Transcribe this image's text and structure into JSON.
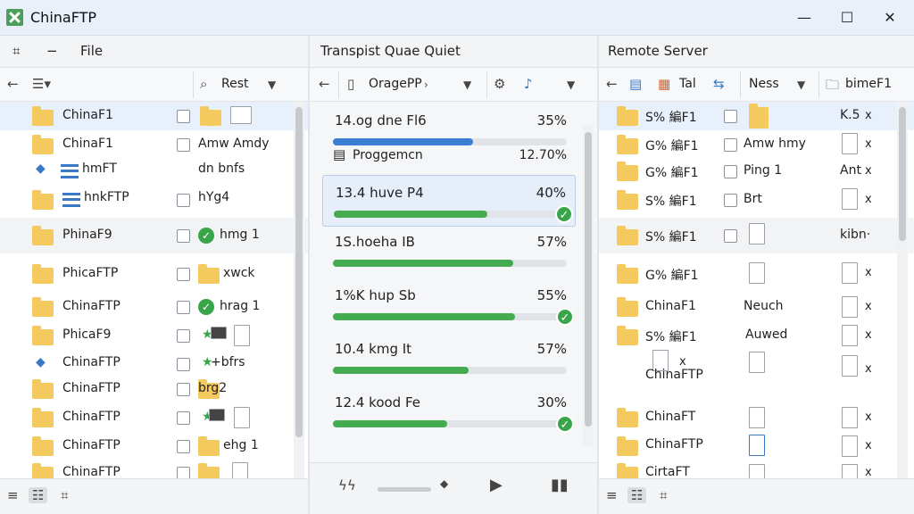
{
  "window": {
    "title": "ChinaFTP",
    "minimize": "—",
    "maximize": "☐",
    "close": "✕"
  },
  "left": {
    "tab_label": "File",
    "toolbar": {
      "sort_label": "Rest"
    },
    "rows": [
      {
        "name": "ChinaF1",
        "col2": ""
      },
      {
        "name": "ChinaF1",
        "col2": "Amw Amdy"
      },
      {
        "name": "hmFT",
        "col2": "dn bnfs"
      },
      {
        "name": "hnkFTP",
        "col2": "hYg4"
      },
      {
        "name": "PhinaF9",
        "col2": "hmg 1"
      },
      {
        "name": "PhicaFTP",
        "col2": "xwck"
      },
      {
        "name": "ChinaFTP",
        "col2": "hrag 1"
      },
      {
        "name": "PhicaF9",
        "col2": ""
      },
      {
        "name": "ChinaFTP",
        "col2": "+bfrs"
      },
      {
        "name": "ChinaFTP",
        "col2": "brg2"
      },
      {
        "name": "ChinaFTP",
        "col2": ""
      },
      {
        "name": "ChinaFTP",
        "col2": "ehg 1"
      },
      {
        "name": "ChinaFTP",
        "col2": ""
      }
    ]
  },
  "queue": {
    "tab_label": "Transpist Quae Quiet",
    "toolbar": {
      "server_label": "OragePP"
    },
    "items": [
      {
        "name": "14.og dne Fl6",
        "percent": "35%",
        "progress": 0.6,
        "color": "#3b7fd4",
        "sub": "Proggemcn",
        "sub_value": "12.70%"
      },
      {
        "name": "13.4 huve P4",
        "percent": "40%",
        "progress": 0.66,
        "color": "#45ab50"
      },
      {
        "name": "1S.hoeha IB",
        "percent": "57%",
        "progress": 0.77,
        "color": "#45ab50"
      },
      {
        "name": "1%K hup Sb",
        "percent": "55%",
        "progress": 0.78,
        "color": "#45ab50"
      },
      {
        "name": "10.4 kmg It",
        "percent": "57%",
        "progress": 0.58,
        "color": "#45ab50"
      },
      {
        "name": "12.4 kood Fe",
        "percent": "30%",
        "progress": 0.49,
        "color": "#45ab50"
      }
    ]
  },
  "right": {
    "tab_label": "Remote Server",
    "toolbar": {
      "tab_label": "Tal",
      "ness_label": "Ness",
      "folder_label": "bimeF1"
    },
    "rows": [
      {
        "name": "S% 編F1",
        "col2": "",
        "col3": "K.5"
      },
      {
        "name": "G% 編F1",
        "col2": "Amw hmy",
        "col3": ""
      },
      {
        "name": "G% 編F1",
        "col2": "Ping 1",
        "col3": "Ant"
      },
      {
        "name": "S% 編F1",
        "col2": "Brt",
        "col3": ""
      },
      {
        "name": "S% 編F1",
        "col2": "",
        "col3": "kibn·"
      },
      {
        "name": "G% 編F1",
        "col2": "",
        "col3": ""
      },
      {
        "name": "ChinaF1",
        "col2": "Neuch",
        "col3": ""
      },
      {
        "name": "S% 編F1",
        "col2": "Auwed",
        "col3": ""
      },
      {
        "name": "ChinaFTP",
        "col2": "",
        "col3": ""
      },
      {
        "name": "ChinaFT",
        "col2": "",
        "col3": ""
      },
      {
        "name": "ChinaFTP",
        "col2": "",
        "col3": ""
      },
      {
        "name": "CirtaFT",
        "col2": "",
        "col3": ""
      }
    ]
  },
  "colors": {
    "accent_blue": "#3b7fd4",
    "progress_green": "#45ab50",
    "folder": "#f4c95e"
  }
}
